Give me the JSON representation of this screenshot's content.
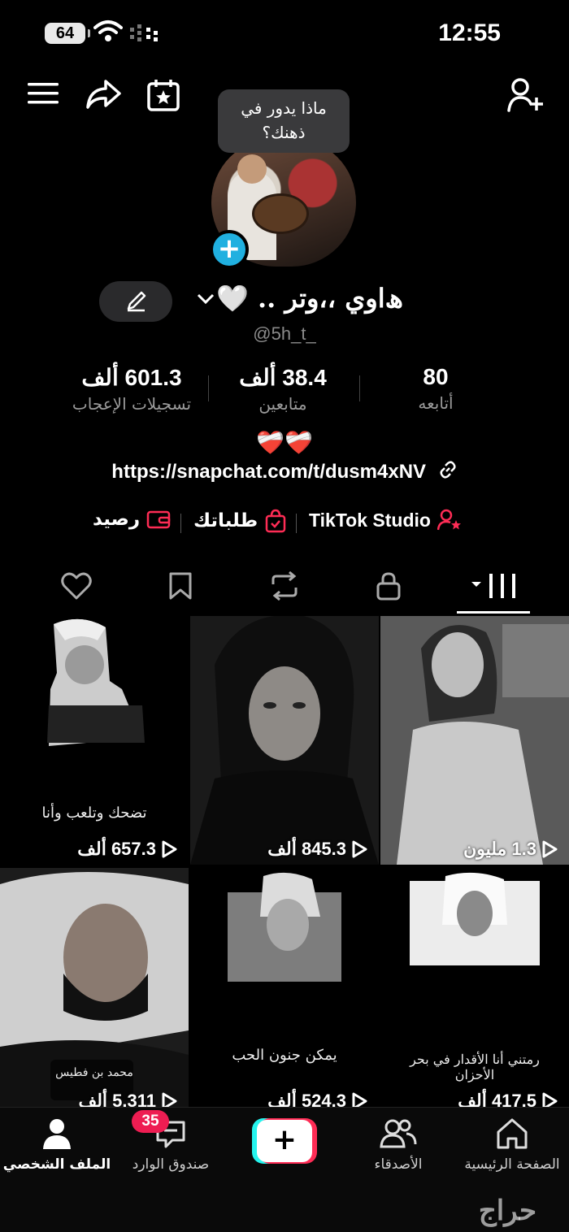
{
  "status": {
    "battery": "64",
    "time": "12:55"
  },
  "tooltip": "ماذا يدور في ذهنك؟",
  "profile": {
    "name": "ﮪاوي ،،وتر .. 🤍",
    "handle": "@5h_t_",
    "bio_hearts": "❤️‍🩹❤️‍🩹",
    "link": "https://snapchat.com/t/dusm4xNV"
  },
  "stats": [
    {
      "num": "601.3 ألف",
      "label": "تسجيلات الإعجاب"
    },
    {
      "num": "38.4 ألف",
      "label": "متابعين"
    },
    {
      "num": "80",
      "label": "أتابعه"
    }
  ],
  "tools": {
    "balance": "رصيد",
    "orders": "طلباتك",
    "studio": "TikTok Studio"
  },
  "videos": [
    {
      "views": "657.3 ألف",
      "caption": "تضحك وتلعب وأنا"
    },
    {
      "views": "845.3 ألف",
      "caption": ""
    },
    {
      "views": "1.3 مليون",
      "caption": ""
    },
    {
      "views": "5.311 ألف",
      "caption": "محمد بن فطيس"
    },
    {
      "views": "524.3 ألف",
      "caption": "يمكن جنون الحب"
    },
    {
      "views": "417.5 ألف",
      "caption": "رمتني أنا الأقدار في بحر الأحزان"
    }
  ],
  "bottom_nav": {
    "profile": "الملف الشخصي",
    "inbox": "صندوق الوارد",
    "inbox_badge": "35",
    "friends": "الأصدقاء",
    "home": "الصفحة الرئيسية"
  },
  "watermark": "حراج"
}
